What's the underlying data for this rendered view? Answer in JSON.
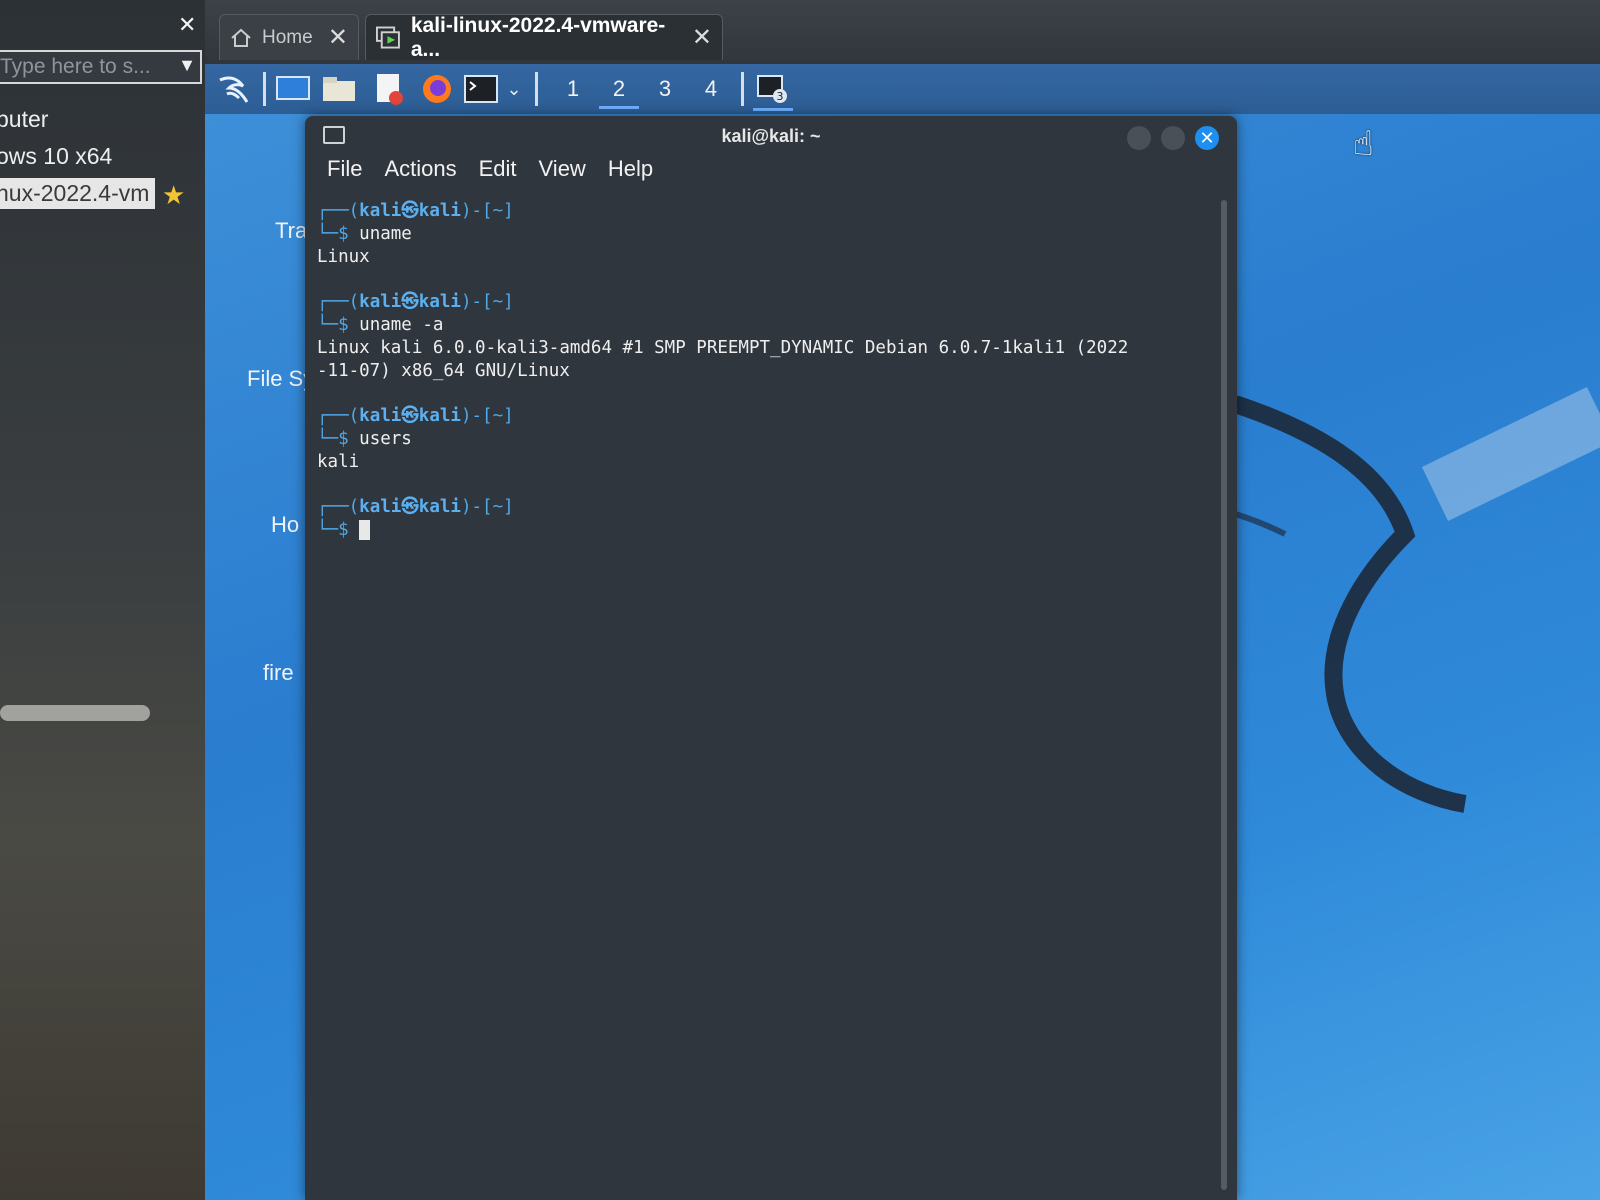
{
  "library": {
    "search_placeholder": "Type here to s...",
    "items": [
      {
        "label": "puter"
      },
      {
        "label": "ows 10 x64"
      },
      {
        "label": "nux-2022.4-vm"
      }
    ]
  },
  "tabs": [
    {
      "label": "Home"
    },
    {
      "label": "kali-linux-2022.4-vmware-a..."
    }
  ],
  "panel": {
    "workspaces": [
      "1",
      "2",
      "3",
      "4"
    ],
    "active_workspace": "2",
    "window_count_badge": "3"
  },
  "desktop_icons": [
    {
      "label": "Tra"
    },
    {
      "label": "File Sy"
    },
    {
      "label": "Ho"
    },
    {
      "label": "fire"
    }
  ],
  "terminal": {
    "title": "kali@kali: ~",
    "menu": [
      "File",
      "Actions",
      "Edit",
      "View",
      "Help"
    ],
    "prompt_user": "kali㉿kali",
    "prompt_dir": "~",
    "entries": [
      {
        "command": "uname",
        "output": [
          "Linux"
        ]
      },
      {
        "command": "uname -a",
        "output": [
          "Linux kali 6.0.0-kali3-amd64 #1 SMP PREEMPT_DYNAMIC Debian 6.0.7-1kali1 (2022",
          "-11-07) x86_64 GNU/Linux"
        ]
      },
      {
        "command": "users",
        "output": [
          "kali"
        ]
      }
    ]
  },
  "colors": {
    "kali_blue": "#2f8ad9",
    "panel_blue": "#3467a2",
    "prompt_blue": "#4fa8e8",
    "terminal_bg": "#30363d",
    "close_button": "#1e8ff0",
    "favorite_star": "#f3c532"
  }
}
